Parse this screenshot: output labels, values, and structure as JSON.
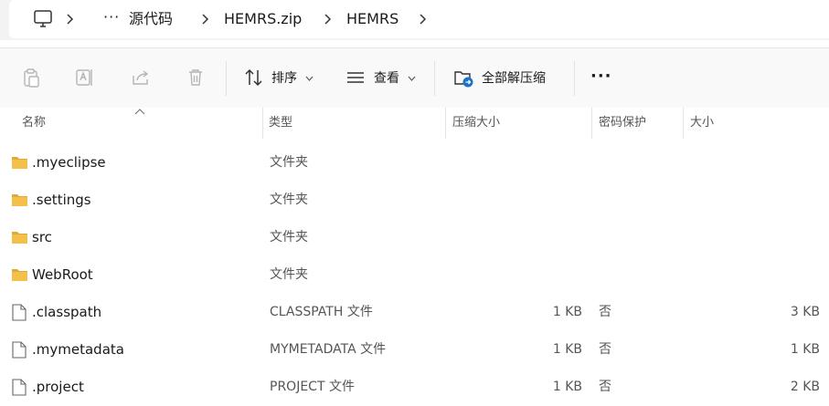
{
  "breadcrumb": {
    "overflow": "···",
    "items": [
      "源代码",
      "HEMRS.zip",
      "HEMRS"
    ]
  },
  "toolbar": {
    "sort_label": "排序",
    "view_label": "查看",
    "extract_label": "全部解压缩",
    "more_label": "···"
  },
  "columns": {
    "name": "名称",
    "type": "类型",
    "compressed_size": "压缩大小",
    "password": "密码保护",
    "size": "大小"
  },
  "rows": [
    {
      "name": ".myeclipse",
      "kind": "folder",
      "type": "文件夹",
      "compressed_size": "",
      "password": "",
      "size": ""
    },
    {
      "name": ".settings",
      "kind": "folder",
      "type": "文件夹",
      "compressed_size": "",
      "password": "",
      "size": ""
    },
    {
      "name": "src",
      "kind": "folder",
      "type": "文件夹",
      "compressed_size": "",
      "password": "",
      "size": ""
    },
    {
      "name": "WebRoot",
      "kind": "folder",
      "type": "文件夹",
      "compressed_size": "",
      "password": "",
      "size": ""
    },
    {
      "name": ".classpath",
      "kind": "file",
      "type": "CLASSPATH 文件",
      "compressed_size": "1 KB",
      "password": "否",
      "size": "3 KB"
    },
    {
      "name": ".mymetadata",
      "kind": "file",
      "type": "MYMETADATA 文件",
      "compressed_size": "1 KB",
      "password": "否",
      "size": "1 KB"
    },
    {
      "name": ".project",
      "kind": "file",
      "type": "PROJECT 文件",
      "compressed_size": "1 KB",
      "password": "否",
      "size": "2 KB"
    }
  ],
  "colors": {
    "folder": "#f4c04a",
    "folder_dark": "#e0a93a",
    "disabled_icon": "#b5b5b5",
    "accent": "#1a73c8"
  }
}
